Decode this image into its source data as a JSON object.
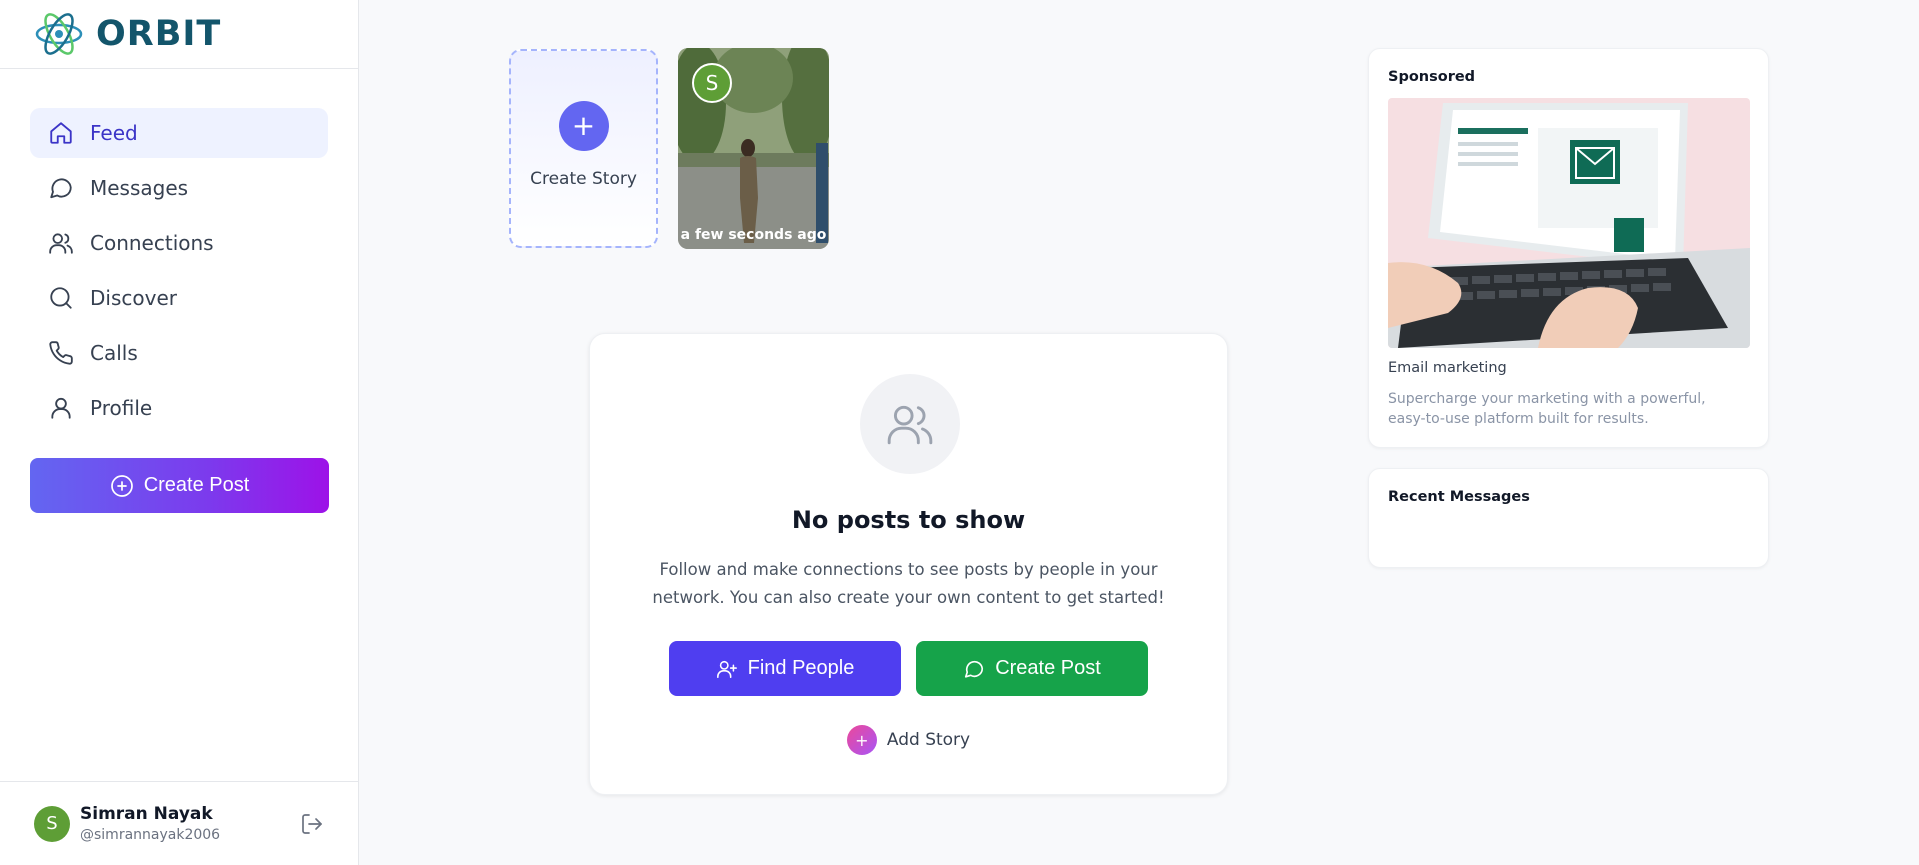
{
  "app": {
    "name": "ORBIT",
    "accent": "#6366f1"
  },
  "sidebar": {
    "items": [
      {
        "label": "Feed",
        "icon": "home-icon",
        "active": true
      },
      {
        "label": "Messages",
        "icon": "message-icon"
      },
      {
        "label": "Connections",
        "icon": "users-icon"
      },
      {
        "label": "Discover",
        "icon": "search-icon"
      },
      {
        "label": "Calls",
        "icon": "phone-icon"
      },
      {
        "label": "Profile",
        "icon": "user-icon"
      }
    ],
    "create_post_label": "Create Post"
  },
  "user": {
    "initial": "S",
    "name": "Simran Nayak",
    "handle": "@simrannayak2006",
    "avatar_color": "#5e9e36"
  },
  "stories": {
    "create_label": "Create Story",
    "items": [
      {
        "initial": "S",
        "time": "a few seconds ago"
      }
    ]
  },
  "feed": {
    "empty_title": "No posts to show",
    "empty_description": "Follow and make connections to see posts by people in your network. You can also create your own content to get started!",
    "find_people_label": "Find People",
    "create_post_label": "Create Post",
    "add_story_label": "Add Story"
  },
  "sponsored": {
    "title": "Sponsored",
    "ad_title": "Email marketing",
    "ad_description": "Supercharge your marketing with a powerful, easy-to-use platform built for results."
  },
  "recent_messages": {
    "title": "Recent Messages"
  }
}
